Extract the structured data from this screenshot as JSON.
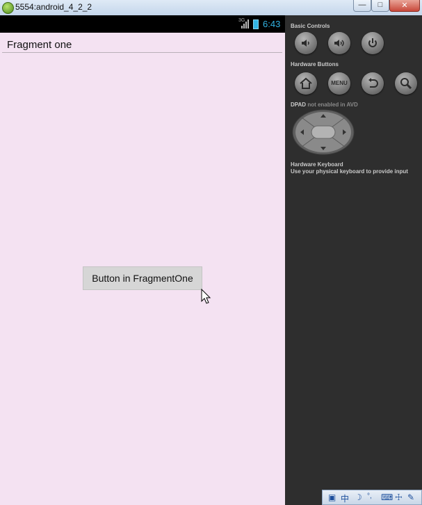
{
  "window": {
    "title": "5554:android_4_2_2",
    "minimize_glyph": "—",
    "maximize_glyph": "□",
    "close_glyph": "✕"
  },
  "status_bar": {
    "network_label": "3G",
    "time": "6:43",
    "accent_color": "#33b5e5"
  },
  "action_bar": {
    "title": "Fragment one"
  },
  "content": {
    "button_label": "Button in FragmentOne",
    "background_color": "#f4e2f2"
  },
  "controls": {
    "basic_controls_label": "Basic Controls",
    "basic_buttons": [
      "volume-down-icon",
      "volume-up-icon",
      "power-icon"
    ],
    "hardware_buttons_label": "Hardware Buttons",
    "menu_label": "MENU",
    "hardware_buttons": [
      "home-icon",
      "menu",
      "back-icon",
      "search-icon"
    ],
    "dpad_label": "DPAD",
    "dpad_note": "not enabled in AVD",
    "keyboard_label": "Hardware Keyboard",
    "keyboard_note": "Use your physical keyboard to provide input"
  },
  "taskbar": {
    "ime_label": "中"
  }
}
